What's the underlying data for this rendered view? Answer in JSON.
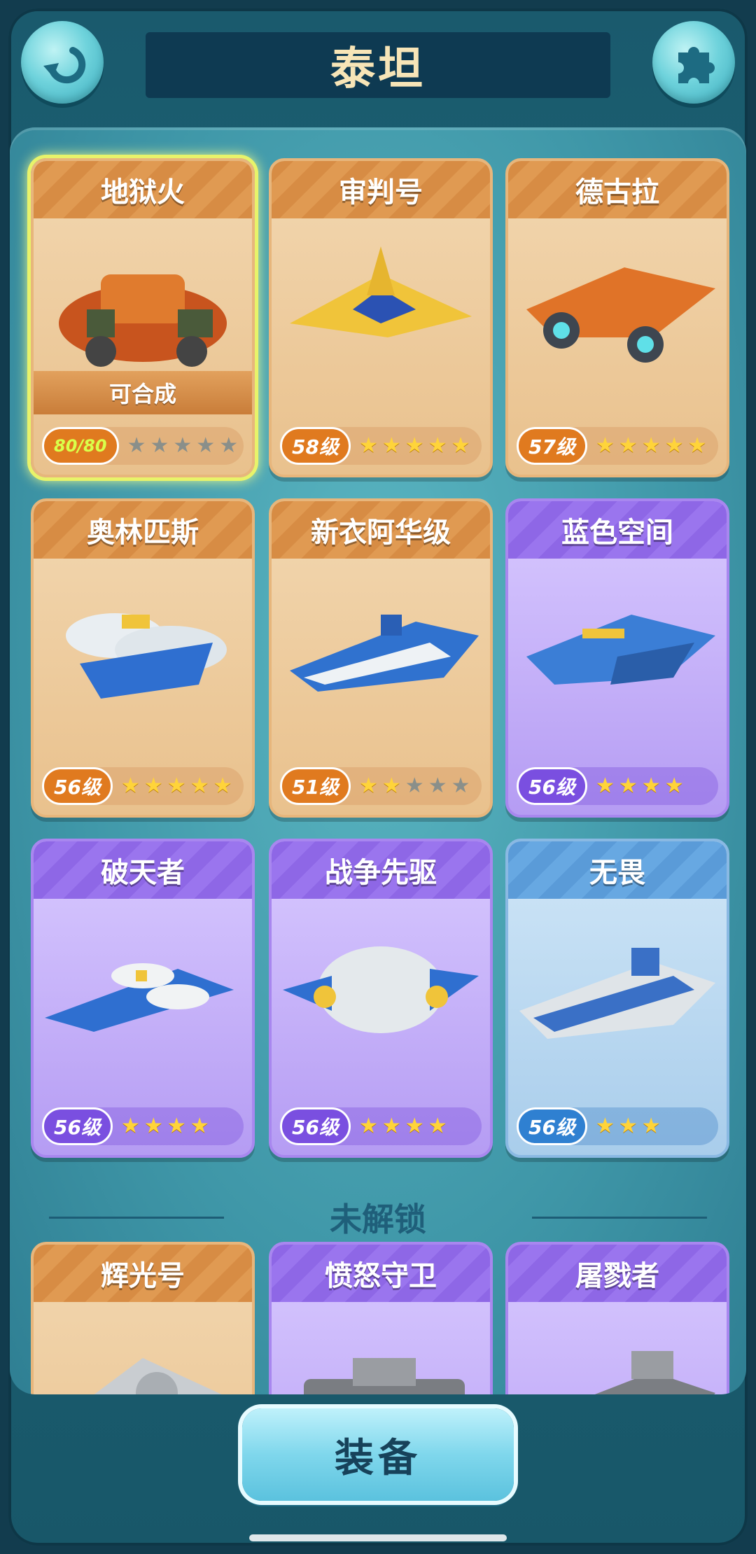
{
  "header": {
    "title": "泰坦",
    "back_icon": "back-arrow-icon",
    "puzzle_icon": "puzzle-icon"
  },
  "cards": [
    {
      "name": "地狱火",
      "rarity": "orange",
      "status": "可合成",
      "fragments": "80/80",
      "stars_on": 0,
      "stars_total": 5,
      "selected": true
    },
    {
      "name": "审判号",
      "rarity": "orange",
      "level": "58级",
      "stars_on": 5,
      "stars_total": 5
    },
    {
      "name": "德古拉",
      "rarity": "orange",
      "level": "57级",
      "stars_on": 5,
      "stars_total": 5
    },
    {
      "name": "奥林匹斯",
      "rarity": "orange",
      "level": "56级",
      "stars_on": 5,
      "stars_total": 5
    },
    {
      "name": "新衣阿华级",
      "rarity": "orange",
      "level": "51级",
      "stars_on": 2,
      "stars_total": 5
    },
    {
      "name": "蓝色空间",
      "rarity": "purple",
      "level": "56级",
      "stars_on": 4,
      "stars_total": 4
    },
    {
      "name": "破天者",
      "rarity": "purple",
      "level": "56级",
      "stars_on": 4,
      "stars_total": 4
    },
    {
      "name": "战争先驱",
      "rarity": "purple",
      "level": "56级",
      "stars_on": 4,
      "stars_total": 4
    },
    {
      "name": "无畏",
      "rarity": "blue",
      "level": "56级",
      "stars_on": 3,
      "stars_total": 3
    }
  ],
  "locked_section": {
    "label": "未解锁",
    "cards": [
      {
        "name": "辉光号",
        "rarity": "orange"
      },
      {
        "name": "愤怒守卫",
        "rarity": "purple"
      },
      {
        "name": "屠戮者",
        "rarity": "purple"
      }
    ]
  },
  "equip_button": "装备",
  "colors": {
    "background": "#123c4e",
    "panel": "#3f97a8",
    "orange_card": "#e9c18d",
    "purple_card": "#b59cf3",
    "blue_card": "#a9cdeb",
    "star": "#ffd43a"
  }
}
